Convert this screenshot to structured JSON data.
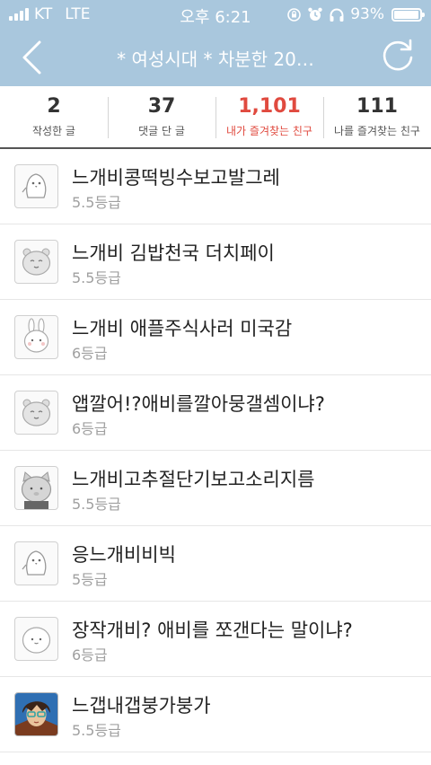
{
  "status_bar": {
    "carrier": "KT",
    "network": "LTE",
    "time": "오후 6:21",
    "battery": "93%",
    "battery_level": 0.93
  },
  "nav": {
    "title": "* 여성시대 *  차분한 20…",
    "back_icon": "chevron-left-icon",
    "refresh_icon": "refresh-icon"
  },
  "stats": [
    {
      "value": "2",
      "label": "작성한 글"
    },
    {
      "value": "37",
      "label": "댓글 단 글"
    },
    {
      "value": "1,101",
      "label": "내가 즐겨찾는 친구"
    },
    {
      "value": "111",
      "label": "나를 즐겨찾는 친구"
    }
  ],
  "colors": {
    "header_bg": "#a9c7dd",
    "accent_red": "#e04a3f",
    "grade_gray": "#a0a0a0"
  },
  "friends": [
    {
      "name": "느개비콩떡빙수보고발그레",
      "grade": "5.5등급",
      "avatar": "penguin"
    },
    {
      "name": "느개비 김밥천국 더치페이",
      "grade": "5.5등급",
      "avatar": "bear"
    },
    {
      "name": "느개비 애플주식사러 미국감",
      "grade": "6등급",
      "avatar": "rabbit"
    },
    {
      "name": "앱깔어!?애비를깔아뭉갤셈이냐?",
      "grade": "6등급",
      "avatar": "bear"
    },
    {
      "name": "느개비고추절단기보고소리지름",
      "grade": "5.5등급",
      "avatar": "cat"
    },
    {
      "name": "응느개비비빅",
      "grade": "5등급",
      "avatar": "penguin"
    },
    {
      "name": "장작개비? 애비를 쪼갠다는 말이냐?",
      "grade": "6등급",
      "avatar": "blob"
    },
    {
      "name": "느갭내갭붕가붕가",
      "grade": "5.5등급",
      "avatar": "photo"
    }
  ]
}
